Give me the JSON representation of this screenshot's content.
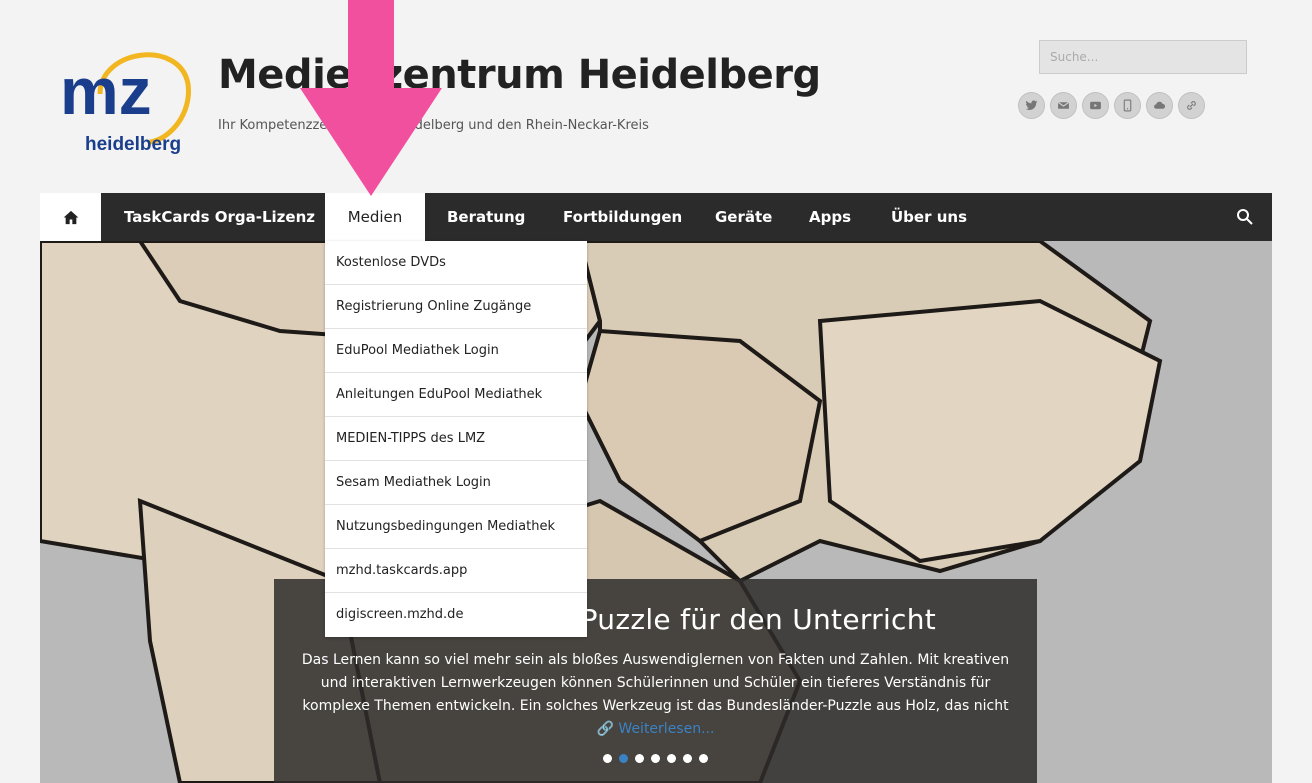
{
  "header": {
    "logo_text_main": "mz",
    "logo_text_sub": "heidelberg",
    "title": "Medienzentrum Heidelberg",
    "tagline": "Ihr Kompetenzzentrum für Heidelberg und den Rhein-Neckar-Kreis",
    "search_placeholder": "Suche..."
  },
  "social_icons": [
    "twitter-icon",
    "mail-icon",
    "youtube-icon",
    "mobile-icon",
    "cloud-icon",
    "link-icon"
  ],
  "nav": {
    "home_icon": "home-icon",
    "items": [
      {
        "label": "TaskCards Orga-Lizenz"
      },
      {
        "label": "Medien"
      },
      {
        "label": "Beratung"
      },
      {
        "label": "Fortbildungen"
      },
      {
        "label": "Geräte"
      },
      {
        "label": "Apps"
      },
      {
        "label": "Über uns"
      }
    ],
    "search_icon": "search-icon"
  },
  "dropdown": {
    "items": [
      {
        "label": "Kostenlose DVDs"
      },
      {
        "label": "Registrierung Online Zugänge"
      },
      {
        "label": "EduPool Mediathek Login"
      },
      {
        "label": "Anleitungen EduPool Mediathek"
      },
      {
        "label": "MEDIEN-TIPPS des LMZ"
      },
      {
        "label": "Sesam Mediathek Login"
      },
      {
        "label": "Nutzungsbedingungen Mediathek"
      },
      {
        "label": "mzhd.taskcards.app"
      },
      {
        "label": "digiscreen.mzhd.de"
      }
    ]
  },
  "slider": {
    "title": "Bundesländer-Puzzle für den Unterricht",
    "text": "Das Lernen kann so viel mehr sein als bloßes Auswendiglernen von Fakten und Zahlen. Mit kreativen und interaktiven Lernwerkzeugen können Schülerinnen und Schüler ein tieferes Verständnis für komplexe Themen entwickeln. Ein solches Werkzeug ist das Bundesländer-Puzzle aus Holz, das nicht",
    "read_more": "Weiterlesen...",
    "dot_count": 7,
    "active_dot": 1
  },
  "colors": {
    "nav_bg": "#2b2b2b",
    "accent_blue": "#3b82c4",
    "arrow_pink": "#f0509e",
    "logo_blue": "#1a3e8c",
    "logo_yellow": "#f2b720"
  }
}
